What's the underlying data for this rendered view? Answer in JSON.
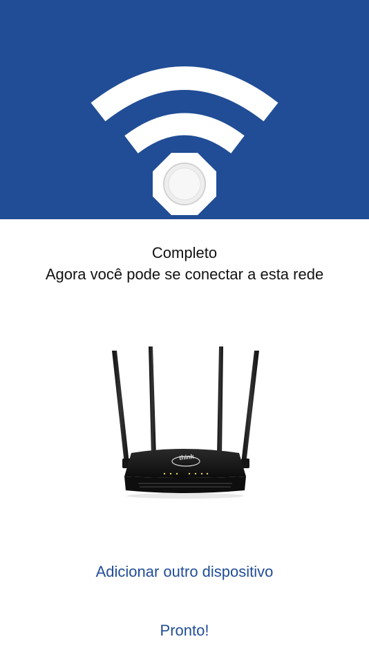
{
  "status": {
    "title": "Completo",
    "subtitle": "Agora você pode se conectar a esta rede"
  },
  "hero": {
    "icon": "wifi-icon",
    "background": "#214d96"
  },
  "router": {
    "brand": "think"
  },
  "actions": {
    "add_device_label": "Adicionar outro dispositivo",
    "done_label": "Pronto!"
  },
  "colors": {
    "accent": "#214d96",
    "text": "#111111"
  }
}
